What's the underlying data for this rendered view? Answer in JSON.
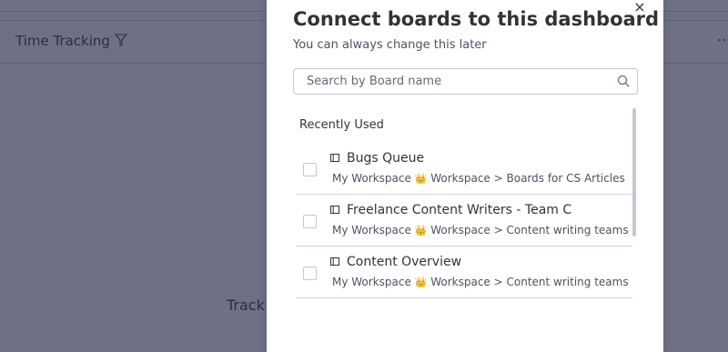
{
  "background": {
    "widget_title": "Time Tracking",
    "body_text": "Track",
    "more_label": "…"
  },
  "modal": {
    "title": "Connect boards to this dashboard",
    "subtitle": "You can always change this later",
    "close_label": "×",
    "search": {
      "placeholder": "Search by Board name",
      "value": ""
    },
    "section_label": "Recently Used",
    "items": [
      {
        "name": "Bugs Queue",
        "workspace": "My Workspace",
        "crown": "👑",
        "path": "Workspace > Boards for CS Articles"
      },
      {
        "name": "Freelance Content Writers - Team C",
        "workspace": "My Workspace",
        "crown": "👑",
        "path": "Workspace > Content writing teams"
      },
      {
        "name": "Content Overview",
        "workspace": "My Workspace",
        "crown": "👑",
        "path": "Workspace > Content writing teams"
      }
    ]
  }
}
